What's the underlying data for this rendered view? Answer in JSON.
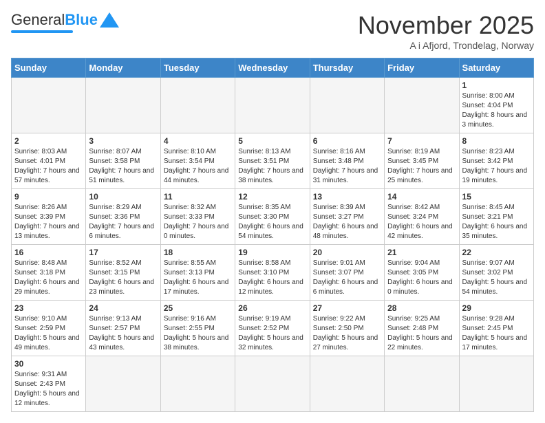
{
  "header": {
    "logo_general": "General",
    "logo_blue": "Blue",
    "month_title": "November 2025",
    "subtitle": "A i Afjord, Trondelag, Norway"
  },
  "weekdays": [
    "Sunday",
    "Monday",
    "Tuesday",
    "Wednesday",
    "Thursday",
    "Friday",
    "Saturday"
  ],
  "weeks": [
    [
      {
        "day": "",
        "info": ""
      },
      {
        "day": "",
        "info": ""
      },
      {
        "day": "",
        "info": ""
      },
      {
        "day": "",
        "info": ""
      },
      {
        "day": "",
        "info": ""
      },
      {
        "day": "",
        "info": ""
      },
      {
        "day": "1",
        "info": "Sunrise: 8:00 AM\nSunset: 4:04 PM\nDaylight: 8 hours and 3 minutes."
      }
    ],
    [
      {
        "day": "2",
        "info": "Sunrise: 8:03 AM\nSunset: 4:01 PM\nDaylight: 7 hours and 57 minutes."
      },
      {
        "day": "3",
        "info": "Sunrise: 8:07 AM\nSunset: 3:58 PM\nDaylight: 7 hours and 51 minutes."
      },
      {
        "day": "4",
        "info": "Sunrise: 8:10 AM\nSunset: 3:54 PM\nDaylight: 7 hours and 44 minutes."
      },
      {
        "day": "5",
        "info": "Sunrise: 8:13 AM\nSunset: 3:51 PM\nDaylight: 7 hours and 38 minutes."
      },
      {
        "day": "6",
        "info": "Sunrise: 8:16 AM\nSunset: 3:48 PM\nDaylight: 7 hours and 31 minutes."
      },
      {
        "day": "7",
        "info": "Sunrise: 8:19 AM\nSunset: 3:45 PM\nDaylight: 7 hours and 25 minutes."
      },
      {
        "day": "8",
        "info": "Sunrise: 8:23 AM\nSunset: 3:42 PM\nDaylight: 7 hours and 19 minutes."
      }
    ],
    [
      {
        "day": "9",
        "info": "Sunrise: 8:26 AM\nSunset: 3:39 PM\nDaylight: 7 hours and 13 minutes."
      },
      {
        "day": "10",
        "info": "Sunrise: 8:29 AM\nSunset: 3:36 PM\nDaylight: 7 hours and 6 minutes."
      },
      {
        "day": "11",
        "info": "Sunrise: 8:32 AM\nSunset: 3:33 PM\nDaylight: 7 hours and 0 minutes."
      },
      {
        "day": "12",
        "info": "Sunrise: 8:35 AM\nSunset: 3:30 PM\nDaylight: 6 hours and 54 minutes."
      },
      {
        "day": "13",
        "info": "Sunrise: 8:39 AM\nSunset: 3:27 PM\nDaylight: 6 hours and 48 minutes."
      },
      {
        "day": "14",
        "info": "Sunrise: 8:42 AM\nSunset: 3:24 PM\nDaylight: 6 hours and 42 minutes."
      },
      {
        "day": "15",
        "info": "Sunrise: 8:45 AM\nSunset: 3:21 PM\nDaylight: 6 hours and 35 minutes."
      }
    ],
    [
      {
        "day": "16",
        "info": "Sunrise: 8:48 AM\nSunset: 3:18 PM\nDaylight: 6 hours and 29 minutes."
      },
      {
        "day": "17",
        "info": "Sunrise: 8:52 AM\nSunset: 3:15 PM\nDaylight: 6 hours and 23 minutes."
      },
      {
        "day": "18",
        "info": "Sunrise: 8:55 AM\nSunset: 3:13 PM\nDaylight: 6 hours and 17 minutes."
      },
      {
        "day": "19",
        "info": "Sunrise: 8:58 AM\nSunset: 3:10 PM\nDaylight: 6 hours and 12 minutes."
      },
      {
        "day": "20",
        "info": "Sunrise: 9:01 AM\nSunset: 3:07 PM\nDaylight: 6 hours and 6 minutes."
      },
      {
        "day": "21",
        "info": "Sunrise: 9:04 AM\nSunset: 3:05 PM\nDaylight: 6 hours and 0 minutes."
      },
      {
        "day": "22",
        "info": "Sunrise: 9:07 AM\nSunset: 3:02 PM\nDaylight: 5 hours and 54 minutes."
      }
    ],
    [
      {
        "day": "23",
        "info": "Sunrise: 9:10 AM\nSunset: 2:59 PM\nDaylight: 5 hours and 49 minutes."
      },
      {
        "day": "24",
        "info": "Sunrise: 9:13 AM\nSunset: 2:57 PM\nDaylight: 5 hours and 43 minutes."
      },
      {
        "day": "25",
        "info": "Sunrise: 9:16 AM\nSunset: 2:55 PM\nDaylight: 5 hours and 38 minutes."
      },
      {
        "day": "26",
        "info": "Sunrise: 9:19 AM\nSunset: 2:52 PM\nDaylight: 5 hours and 32 minutes."
      },
      {
        "day": "27",
        "info": "Sunrise: 9:22 AM\nSunset: 2:50 PM\nDaylight: 5 hours and 27 minutes."
      },
      {
        "day": "28",
        "info": "Sunrise: 9:25 AM\nSunset: 2:48 PM\nDaylight: 5 hours and 22 minutes."
      },
      {
        "day": "29",
        "info": "Sunrise: 9:28 AM\nSunset: 2:45 PM\nDaylight: 5 hours and 17 minutes."
      }
    ],
    [
      {
        "day": "30",
        "info": "Sunrise: 9:31 AM\nSunset: 2:43 PM\nDaylight: 5 hours and 12 minutes."
      },
      {
        "day": "",
        "info": ""
      },
      {
        "day": "",
        "info": ""
      },
      {
        "day": "",
        "info": ""
      },
      {
        "day": "",
        "info": ""
      },
      {
        "day": "",
        "info": ""
      },
      {
        "day": "",
        "info": ""
      }
    ]
  ]
}
